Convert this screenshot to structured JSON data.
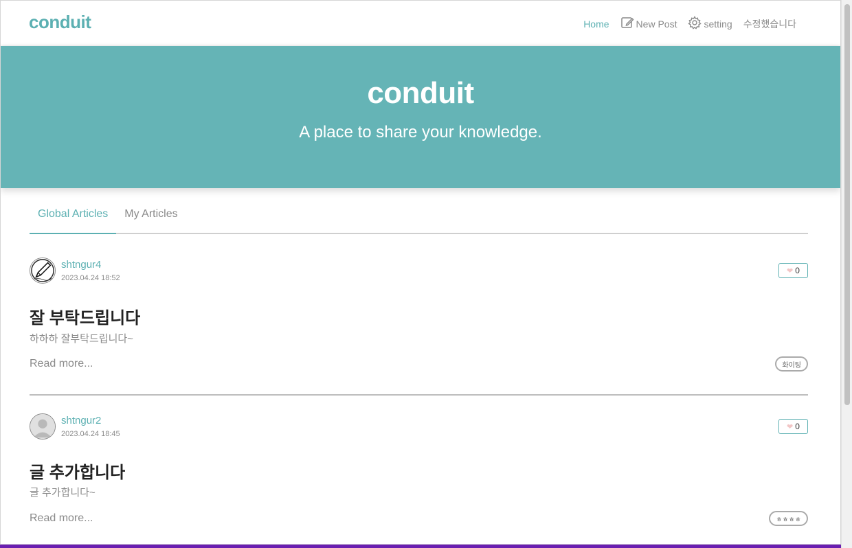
{
  "nav": {
    "brand": "conduit",
    "links": [
      {
        "label": "Home",
        "icon": "none",
        "active": true
      },
      {
        "label": "New Post",
        "icon": "edit-icon",
        "active": false
      },
      {
        "label": "setting",
        "icon": "gear-icon",
        "active": false
      },
      {
        "label": "수정했습니다",
        "icon": "none",
        "active": false
      }
    ]
  },
  "banner": {
    "title": "conduit",
    "subtitle": "A place to share your knowledge."
  },
  "feed": {
    "tabs": [
      {
        "label": "Global Articles",
        "active": true
      },
      {
        "label": "My Articles",
        "active": false
      }
    ],
    "articles": [
      {
        "author": "shtngur4",
        "date": "2023.04.24 18:52",
        "likes": "0",
        "title": "잘 부탁드립니다",
        "description": "하하하 잘부탁드립니다~",
        "read_more": "Read more...",
        "tag": "화이팅",
        "avatar": "pen-sketch-avatar"
      },
      {
        "author": "shtngur2",
        "date": "2023.04.24 18:45",
        "likes": "0",
        "title": "글 추가합니다",
        "description": "글 추가합니다~",
        "read_more": "Read more...",
        "tag": "ㅎㅎㅎㅎ",
        "avatar": "default-user-avatar"
      }
    ]
  },
  "colors": {
    "accent": "#5cb0b2",
    "banner": "#65b4b6",
    "muted": "#8a8a8a"
  }
}
